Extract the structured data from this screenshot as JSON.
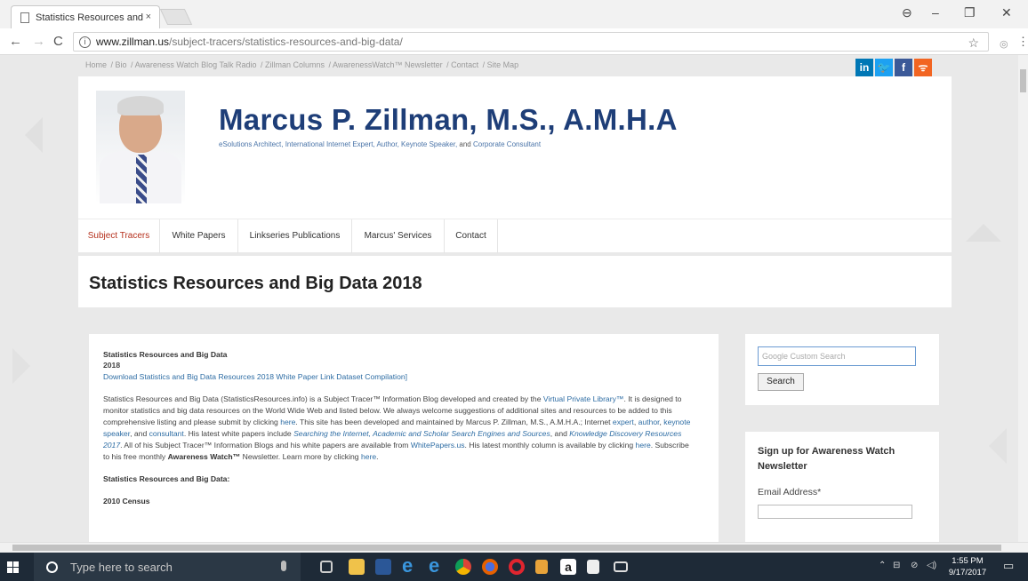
{
  "browser": {
    "tab_title": "Statistics Resources and",
    "tab_close": "×",
    "url_host": "www.zillman.us",
    "url_path": "/subject-tracers/statistics-resources-and-big-data/"
  },
  "site": {
    "topnav": [
      "Home",
      "Bio",
      "Awareness Watch Blog Talk Radio",
      "Zillman Columns",
      "AwarenessWatch™ Newsletter",
      "Contact",
      "Site Map"
    ],
    "social": [
      "in",
      "t",
      "f",
      "rss"
    ],
    "name": "Marcus P. Zillman, M.S., A.M.H.A",
    "tagline_a": "eSolutions Architect, International Internet Expert, Author, Keynote Speaker,",
    "tagline_and": "and",
    "tagline_b": "Corporate Consultant",
    "nav": [
      "Subject Tracers",
      "White Papers",
      "Linkseries Publications",
      "Marcus' Services",
      "Contact"
    ],
    "page_title": "Statistics Resources and Big Data 2018"
  },
  "content": {
    "title": "Statistics Resources and Big Data",
    "year": "2018",
    "download_link": "Download Statistics and Big Data Resources 2018 White Paper Link Dataset Compilation]",
    "p1": "Statistics Resources and Big Data (StatisticsResources.info) is a Subject Tracer™ Information Blog developed and created by the",
    "p1_link": "Virtual Private Library™",
    "p2": ". It is designed to monitor statistics and big data resources on the World Wide Web and listed below. We always welcome suggestions of additional sites and resources to be added to this comprehensive listing and please submit by clicking",
    "here1": "here",
    "p3": ". This site has been developed and maintained by Marcus P. Zillman, M.S., A.M.H.A.; Internet",
    "expert": "expert",
    "author": "author",
    "keynote": "keynote speaker",
    "p4": ", and",
    "consultant": "consultant",
    "p5": ". His latest white papers include",
    "paper1": "Searching the Internet, Academic and Scholar Search Engines and Sources",
    "p6": ", and",
    "paper2": "Knowledge Discovery Resources 2017",
    "p7": ". All of his Subject Tracer™ Information Blogs and his white papers are available from",
    "whitepapers": "WhitePapers.us",
    "p8": ". His latest monthly column is available by clicking",
    "here2": "here",
    "p9": ". Subscribe to his free monthly",
    "aw": "Awareness Watch™",
    "p10": "Newsletter. Learn more by clicking",
    "here3": "here",
    "subheading": "Statistics Resources and Big Data:",
    "census": "2010 Census"
  },
  "sidebar": {
    "search_placeholder": "Google Custom Search",
    "search_button": "Search",
    "newsletter_title": "Sign up for Awareness Watch Newsletter",
    "email_label": "Email Address*"
  },
  "taskbar": {
    "search_placeholder": "Type here to search",
    "time": "1:55 PM",
    "date": "9/17/2017"
  }
}
